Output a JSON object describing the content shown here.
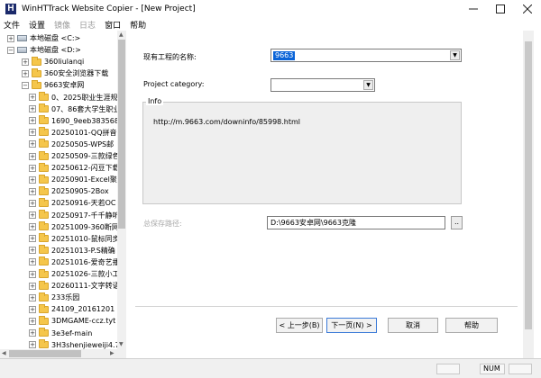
{
  "window": {
    "title": "WinHTTrack Website Copier - [New Project]",
    "icon_letter": "H"
  },
  "menu": [
    {
      "label": "文件",
      "enabled": true
    },
    {
      "label": "设置",
      "enabled": true
    },
    {
      "label": "镜像",
      "enabled": false
    },
    {
      "label": "日志",
      "enabled": false
    },
    {
      "label": "窗口",
      "enabled": true
    },
    {
      "label": "帮助",
      "enabled": true
    }
  ],
  "tree": [
    {
      "label": "本地磁盘 <C:>",
      "type": "drive",
      "expander": "+"
    },
    {
      "label": "本地磁盘 <D:>",
      "type": "drive",
      "expander": "−"
    },
    {
      "label": "360liulanqi",
      "type": "folder",
      "expander": "+"
    },
    {
      "label": "360安全浏览器下载",
      "type": "folder",
      "expander": "+"
    },
    {
      "label": "9663安卓网",
      "type": "folder",
      "expander": "−"
    },
    {
      "label": "0、2025职业生涯规",
      "type": "folder",
      "expander": "+"
    },
    {
      "label": "07、86套大学生职业",
      "type": "folder",
      "expander": "+"
    },
    {
      "label": "1690_9eeb383568",
      "type": "folder",
      "expander": "+"
    },
    {
      "label": "20250101-QQ拼音",
      "type": "folder",
      "expander": "+"
    },
    {
      "label": "20250505-WPS邮",
      "type": "folder",
      "expander": "+"
    },
    {
      "label": "20250509-三款绿色",
      "type": "folder",
      "expander": "+"
    },
    {
      "label": "20250612-闪豆下载",
      "type": "folder",
      "expander": "+"
    },
    {
      "label": "20250901-Excel聚",
      "type": "folder",
      "expander": "+"
    },
    {
      "label": "20250905-2Box",
      "type": "folder",
      "expander": "+"
    },
    {
      "label": "20250916-天若OC",
      "type": "folder",
      "expander": "+"
    },
    {
      "label": "20250917-千千静听",
      "type": "folder",
      "expander": "+"
    },
    {
      "label": "20251009-360断网",
      "type": "folder",
      "expander": "+"
    },
    {
      "label": "20251010-鼠标同步",
      "type": "folder",
      "expander": "+"
    },
    {
      "label": "20251013-P.S精确",
      "type": "folder",
      "expander": "+"
    },
    {
      "label": "20251016-爱奇艺播",
      "type": "folder",
      "expander": "+"
    },
    {
      "label": "20251026-三款小工",
      "type": "folder",
      "expander": "+"
    },
    {
      "label": "20260111-文字转语",
      "type": "folder",
      "expander": "+"
    },
    {
      "label": "233乐园",
      "type": "folder",
      "expander": "+"
    },
    {
      "label": "24109_20161201",
      "type": "folder",
      "expander": "+"
    },
    {
      "label": "3DMGAME-ccz.tyt",
      "type": "folder",
      "expander": "+"
    },
    {
      "label": "3e3ef-main",
      "type": "folder",
      "expander": "+"
    },
    {
      "label": "3H3shenjieweiji4.7",
      "type": "folder",
      "expander": "+"
    }
  ],
  "form": {
    "project_name_label": "现有工程的名称:",
    "project_name_value": "9663",
    "project_category_label": "Project category:",
    "project_category_value": "",
    "info_legend": "Info",
    "info_url": "http://m.9663.com/downinfo/85998.html",
    "base_path_label": "总保存路径:",
    "base_path_value": "D:\\9663安卓网\\9663克隆",
    "browse_label": ".."
  },
  "buttons": {
    "back": "< 上一步(B)",
    "next": "下一页(N) >",
    "cancel": "取消",
    "help": "帮助"
  },
  "status": {
    "num": "NUM"
  }
}
